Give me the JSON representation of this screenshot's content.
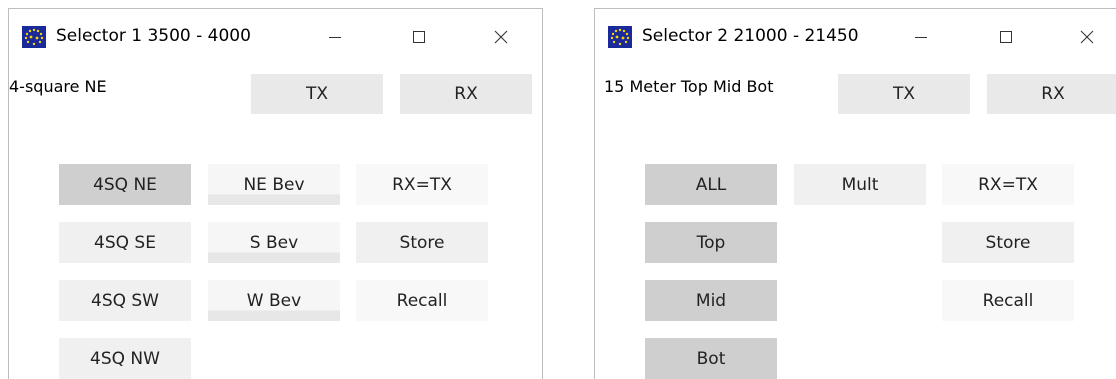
{
  "colors": {
    "icon_bg": "#1a2a9a",
    "icon_stars": "#f5d400",
    "selected_button": "#cfcfcf",
    "button": "#f0f0f0"
  },
  "window1": {
    "title": "Selector 1 3500 - 4000",
    "label": "4-square NE",
    "tx": "TX",
    "rx": "RX",
    "buttons": {
      "sq_ne": "4SQ NE",
      "sq_se": "4SQ SE",
      "sq_sw": "4SQ SW",
      "sq_nw": "4SQ NW",
      "ne_bev": "NE Bev",
      "s_bev": "S Bev",
      "w_bev": "W Bev",
      "rx_eq_tx": "RX=TX",
      "store": "Store",
      "recall": "Recall"
    },
    "icons": {
      "app": "eu-stars-icon",
      "minimize": "minimize-icon",
      "maximize": "maximize-icon",
      "close": "close-icon"
    }
  },
  "window2": {
    "title": "Selector 2 21000 - 21450",
    "label": "15 Meter Top Mid Bot",
    "tx": "TX",
    "rx": "RX",
    "buttons": {
      "all": "ALL",
      "top": "Top",
      "mid": "Mid",
      "bot": "Bot",
      "mult": "Mult",
      "rx_eq_tx": "RX=TX",
      "store": "Store",
      "recall": "Recall"
    },
    "icons": {
      "app": "eu-stars-icon",
      "minimize": "minimize-icon",
      "maximize": "maximize-icon",
      "close": "close-icon"
    }
  }
}
